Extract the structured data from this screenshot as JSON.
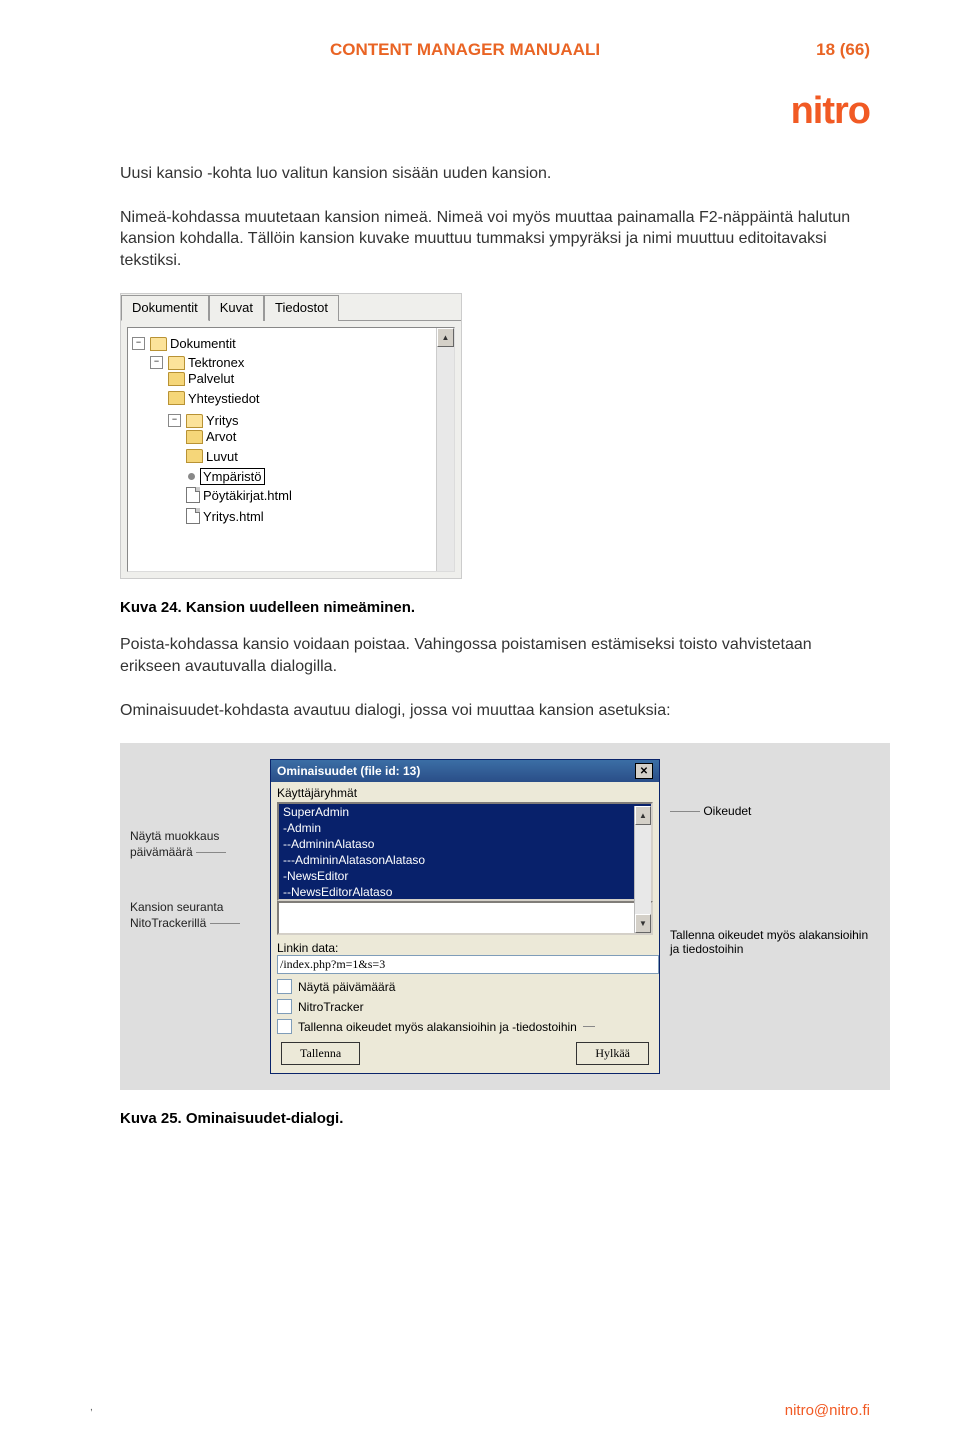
{
  "header": {
    "title": "CONTENT MANAGER MANUAALI",
    "page_indicator": "18 (66)",
    "logo": "nitro"
  },
  "text": {
    "p1": "Uusi kansio -kohta luo valitun kansion sisään uuden kansion.",
    "p2": "Nimeä-kohdassa muutetaan kansion nimeä. Nimeä voi myös muuttaa painamalla F2-näppäintä halutun kansion kohdalla. Tällöin kansion kuvake muuttuu tummaksi ympyräksi ja nimi muuttuu editoitavaksi tekstiksi.",
    "caption1": "Kuva 24. Kansion uudelleen nimeäminen.",
    "p3": "Poista-kohdassa kansio voidaan poistaa. Vahingossa poistamisen estämiseksi toisto vahvistetaan erikseen avautuvalla dialogilla.",
    "p4": "Ominaisuudet-kohdasta avautuu dialogi, jossa voi muuttaa kansion asetuksia:",
    "caption2": "Kuva 25. Ominaisuudet-dialogi."
  },
  "tree_shot": {
    "tabs": [
      "Dokumentit",
      "Kuvat",
      "Tiedostot"
    ],
    "active_tab": 0,
    "nodes": {
      "root": "Dokumentit",
      "l1": "Tektronex",
      "palvelut": "Palvelut",
      "yhteystiedot": "Yhteystiedot",
      "yritys": "Yritys",
      "arvot": "Arvot",
      "luvut": "Luvut",
      "editing": "Ympäristö",
      "file1": "Pöytäkirjat.html",
      "file2": "Yritys.html"
    }
  },
  "props_shot": {
    "left_anno1": "Näytä muokkaus päivämäärä",
    "left_anno2": "Kansion seuranta NitoTrackerillä",
    "right_anno1": "Oikeudet",
    "right_anno2": "Tallenna oikeudet myös alakansioihin ja tiedostoihin",
    "dialog": {
      "title": "Ominaisuudet (file id: 13)",
      "groups_label": "Käyttäjäryhmät",
      "groups": [
        "SuperAdmin",
        "-Admin",
        "--AdmininAlataso",
        "---AdmininAlatasonAlataso",
        "-NewsEditor",
        "--NewsEditorAlataso"
      ],
      "link_label": "Linkin data:",
      "link_value": "/index.php?m=1&s=3",
      "chk1": "Näytä päivämäärä",
      "chk2": "NitroTracker",
      "chk3": "Tallenna oikeudet myös alakansioihin ja -tiedostoihin",
      "btn_save": "Tallenna",
      "btn_cancel": "Hylkää"
    }
  },
  "footer": {
    "email": "nitro@nitro.fi"
  }
}
